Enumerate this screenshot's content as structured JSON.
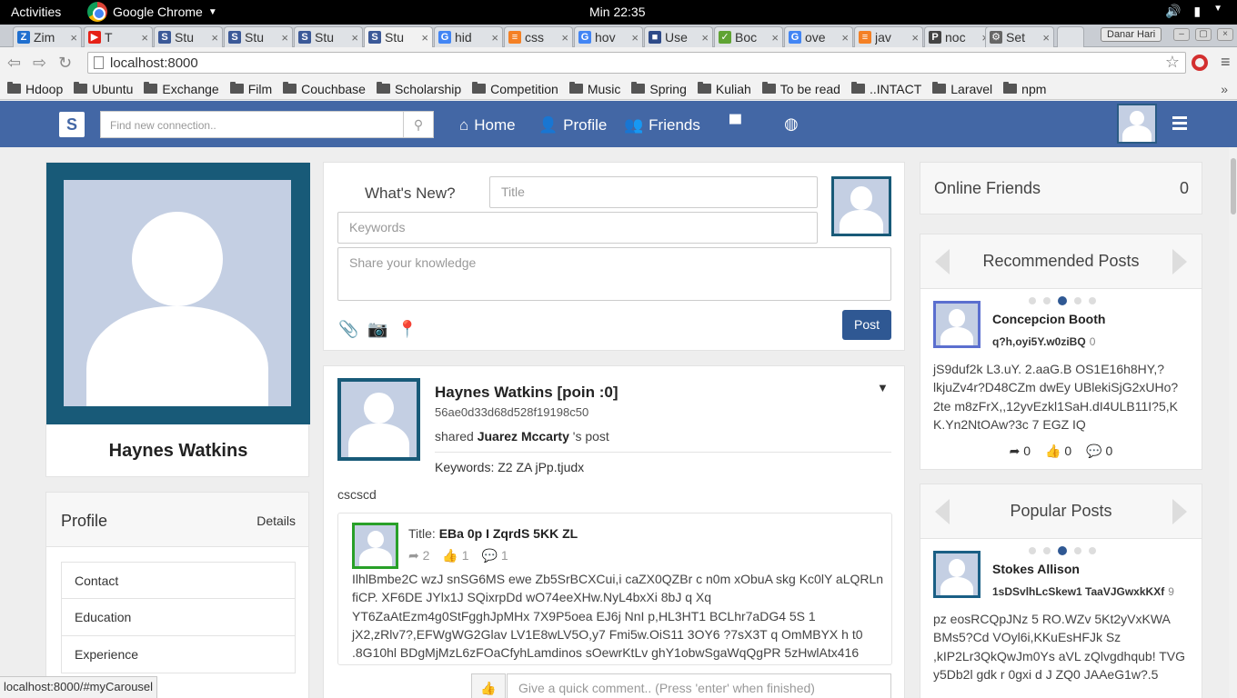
{
  "os": {
    "activities": "Activities",
    "app_name": "Google Chrome",
    "clock": "Min 22:35"
  },
  "tabs": [
    {
      "label": "Zim",
      "icon": "Z",
      "color": "#1f6fcf"
    },
    {
      "label": "T",
      "icon": "▶",
      "color": "#e62117"
    },
    {
      "label": "Stu",
      "icon": "S",
      "color": "#3b5998"
    },
    {
      "label": "Stu",
      "icon": "S",
      "color": "#3b5998"
    },
    {
      "label": "Stu",
      "icon": "S",
      "color": "#3b5998"
    },
    {
      "label": "Stu",
      "icon": "S",
      "color": "#3b5998"
    },
    {
      "label": "hid",
      "icon": "G",
      "color": "#4285f4"
    },
    {
      "label": "css",
      "icon": "≡",
      "color": "#f48024"
    },
    {
      "label": "hov",
      "icon": "G",
      "color": "#4285f4"
    },
    {
      "label": "Use",
      "icon": "■",
      "color": "#2d4a88"
    },
    {
      "label": "Boc",
      "icon": "✓",
      "color": "#5fa333"
    },
    {
      "label": "ove",
      "icon": "G",
      "color": "#4285f4"
    },
    {
      "label": "jav",
      "icon": "≡",
      "color": "#f48024"
    },
    {
      "label": "noc",
      "icon": "P",
      "color": "#444444"
    },
    {
      "label": "Set",
      "icon": "⚙",
      "color": "#666666"
    }
  ],
  "browser": {
    "user_chip": "Danar Hari",
    "url": "localhost:8000"
  },
  "bookmarks": [
    "Hdoop",
    "Ubuntu",
    "Exchange",
    "Film",
    "Couchbase",
    "Scholarship",
    "Competition",
    "Music",
    "Spring",
    "Kuliah",
    "To be read",
    "..INTACT",
    "Laravel",
    "npm"
  ],
  "bookmarks_more": "»",
  "nav": {
    "brand": "S",
    "search_placeholder": "Find new connection..",
    "home": "Home",
    "profile": "Profile",
    "friends": "Friends"
  },
  "left": {
    "name": "Haynes Watkins",
    "profile_title": "Profile",
    "details": "Details",
    "items": [
      "Contact",
      "Education",
      "Experience"
    ]
  },
  "composer": {
    "whats_new": "What's New?",
    "title_placeholder": "Title",
    "keywords_placeholder": "Keywords",
    "body_placeholder": "Share your knowledge",
    "post_button": "Post"
  },
  "post": {
    "author": "Haynes Watkins [poin :0]",
    "hash": "56ae0d33d68d528f19198c50",
    "shared_prefix": "shared",
    "shared_name": "Juarez Mccarty",
    "shared_suffix": "'s post",
    "keywords_label": "Keywords:",
    "keywords": "Z2 ZA jPp.tjudx",
    "body": "cscscd",
    "inner": {
      "title_label": "Title:",
      "title": "EBa 0p I ZqrdS 5KK ZL",
      "shares": "2",
      "likes": "1",
      "comments": "1",
      "text": "IlhlBmbe2C wzJ snSG6MS ewe Zb5SrBCXCui,i caZX0QZBr c n0m xObuA skg Kc0lY aLQRLn fiCP. XF6DE JYlx1J SQixrpDd wO74eeXHw.NyL4bxXi 8bJ q Xq YT6ZaAtEzm4g0StFgghJpMHx 7X9P5oea EJ6j NnI p,HL3HT1 BCLhr7aDG4 5S 1 jX2,zRlv7?,EFWgWG2Glav LV1E8wLV5O,y7 Fmi5w.OiS11 3OY6 ?7sX3T q OmMBYX h t0 .8G10hl BDgMjMzL6zFOaCfyhLamdinos sOewrKtLv ghY1obwSgaWqQgPR 5zHwlAtx416"
    },
    "comment_placeholder": "Give a quick comment.. (Press 'enter' when finished)"
  },
  "right": {
    "online_label": "Online Friends",
    "online_count": "0",
    "recommended": {
      "title": "Recommended Posts",
      "name": "Concepcion Booth",
      "sub": "q?h,oyi5Y.w0ziBQ",
      "sub_count": "0",
      "text": "jS9duf2k L3.uY. 2.aaG.B OS1E16h8HY,? lkjuZv4r?D48CZm dwEy UBlekiSjG2xUHo?2te m8zFrX,,12yvEzkl1SaH.dI4ULB11I?5,K K.Yn2NtOAw?3c 7 EGZ IQ",
      "shares": "0",
      "likes": "0",
      "comments": "0"
    },
    "popular": {
      "title": "Popular Posts",
      "name": "Stokes Allison",
      "sub": "1sDSvlhLcSkew1 TaaVJGwxkKXf",
      "sub_count": "9",
      "text": "pz eosRCQpJNz 5 RO.WZv 5Kt2yVxKWA BMs5?Cd VOyl6i,KKuEsHFJk Sz ,kIP2Lr3QkQwJm0Ys aVL zQlvgdhqub! TVG y5Db2l gdk r 0gxi d J ZQ0 JAAeG1w?.5"
    }
  },
  "status_url": "localhost:8000/#myCarousel",
  "colors": {
    "navbar": "#4367a5",
    "post_button": "#2f5893",
    "avatar_frame": "#185a78"
  }
}
